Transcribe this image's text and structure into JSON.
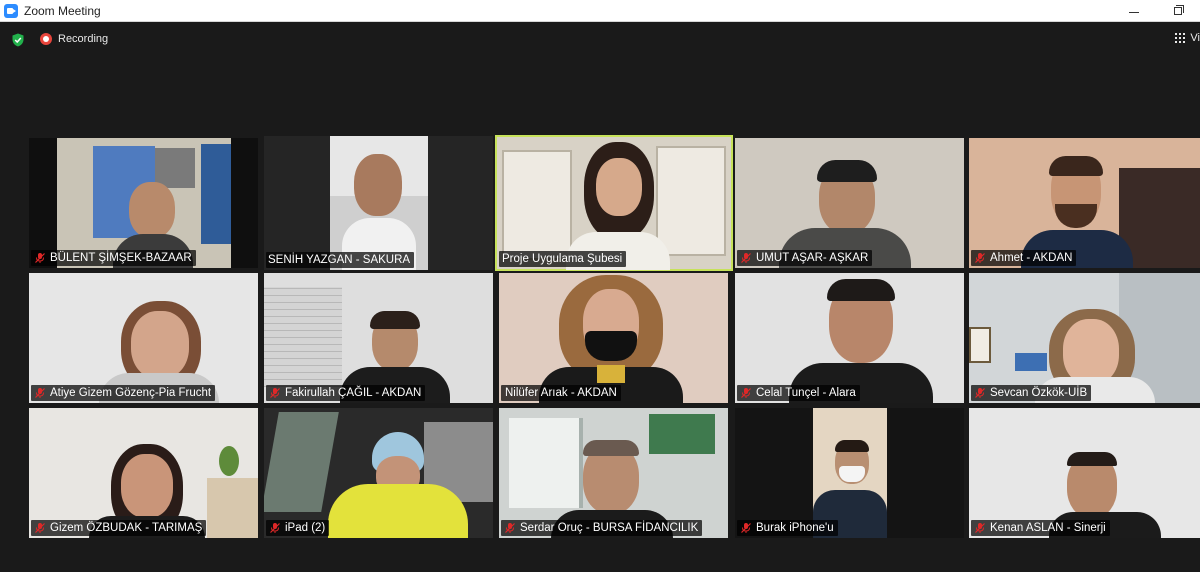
{
  "window": {
    "title": "Zoom Meeting"
  },
  "top_bar": {
    "recording_label": "Recording",
    "view_label": "Vi",
    "icons": [
      "shield-icon",
      "recording-icon",
      "grid-view-icon"
    ]
  },
  "accent_colors": {
    "active_speaker_border": "#c7e25a",
    "recording_red": "#e8453c",
    "mic_muted_red": "#e02828",
    "shield_green": "#22b14c"
  },
  "participants": [
    {
      "name": "BÜLENT ŞİMŞEK-BAZAAR",
      "muted": true
    },
    {
      "name": "SENİH YAZGAN - SAKURA",
      "muted": false
    },
    {
      "name": "Proje Uygulama Şubesi",
      "muted": false,
      "active_speaker": true
    },
    {
      "name": "UMUT AŞAR- AŞKAR",
      "muted": true
    },
    {
      "name": "Ahmet - AKDAN",
      "muted": true
    },
    {
      "name": "Atiye Gizem Gözenç-Pia Frucht",
      "muted": true
    },
    {
      "name": "Fakirullah ÇAĞIL - AKDAN",
      "muted": true
    },
    {
      "name": "Nilüfer Arıak - AKDAN",
      "muted": false
    },
    {
      "name": "Celal Tunçel - Alara",
      "muted": true
    },
    {
      "name": "Sevcan Özkök-UİB",
      "muted": true
    },
    {
      "name": "Gizem ÖZBUDAK - TARIMAŞ",
      "muted": true
    },
    {
      "name": "iPad (2)",
      "muted": true
    },
    {
      "name": "Serdar Oruç - BURSA FİDANCILIK",
      "muted": true
    },
    {
      "name": "Burak iPhone'u",
      "muted": true
    },
    {
      "name": "Kenan ASLAN - Sinerji",
      "muted": true
    }
  ]
}
